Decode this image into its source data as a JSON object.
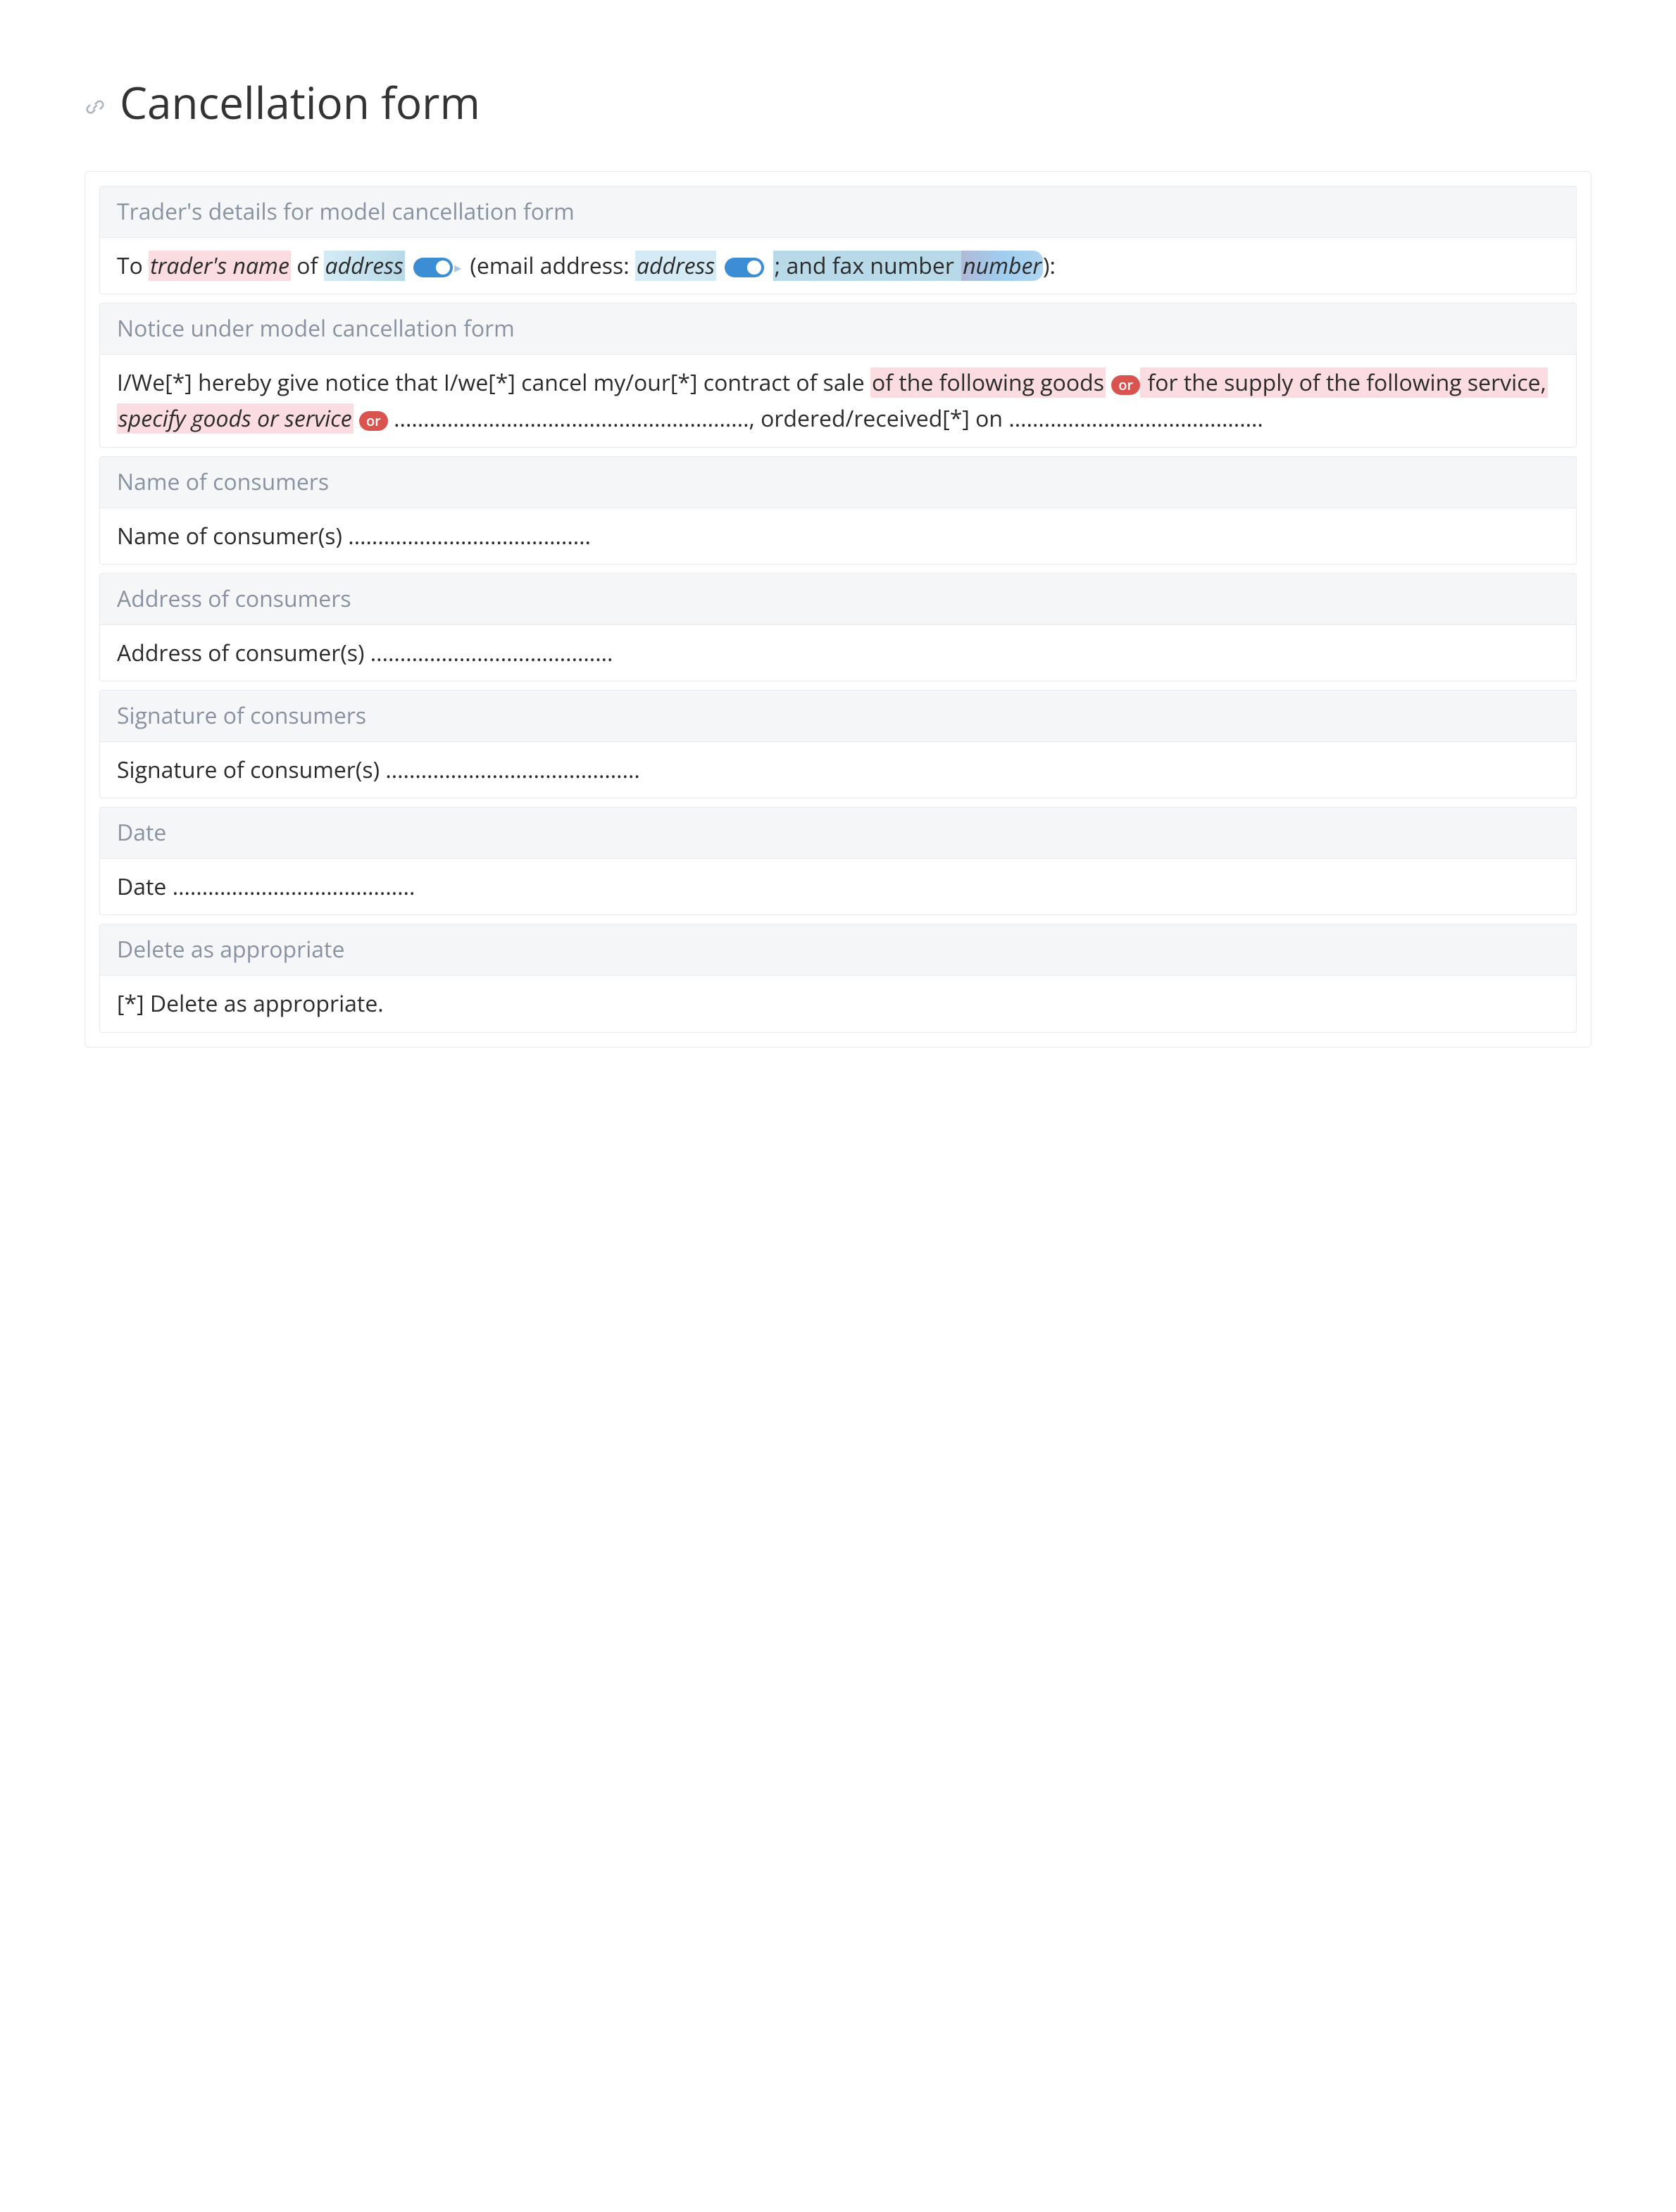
{
  "page": {
    "title": "Cancellation form"
  },
  "sections": {
    "trader_details": {
      "header": "Trader's details for model cancellation form",
      "text": {
        "prefix": "To ",
        "traders_name": "trader's name",
        "of": " of ",
        "address1": "address",
        "email_prefix": " (email address: ",
        "address2": "address",
        "fax_prefix": " ; and fax number ",
        "number": "number",
        "suffix": "):"
      }
    },
    "notice": {
      "header": "Notice under model cancellation form",
      "text": {
        "part1": "I/We[*] hereby give notice that I/we[*] cancel my/our[*] contract of sale ",
        "part2_hl": "of the following goods",
        "or_badge": "or",
        "part3_hl": " for the supply of the following service, ",
        "part4_hl_italic": "specify goods or service",
        "or_badge2": "or",
        "dots1": " ............................................................, ordered/received[*] on ..........................................."
      }
    },
    "name_consumers": {
      "header": "Name of consumers",
      "body": "Name of consumer(s) ........................................."
    },
    "address_consumers": {
      "header": "Address of consumers",
      "body": "Address of consumer(s) ........................................."
    },
    "signature_consumers": {
      "header": "Signature of consumers",
      "body": "Signature of consumer(s) ..........................................."
    },
    "date": {
      "header": "Date",
      "body": "Date ........................................."
    },
    "delete": {
      "header": "Delete as appropriate",
      "body": "[*] Delete as appropriate."
    }
  }
}
